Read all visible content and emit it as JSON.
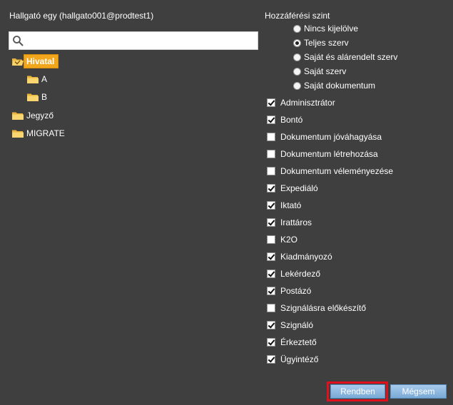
{
  "user": {
    "label": "Hallgató egy (hallgato001@prodtest1)"
  },
  "search": {
    "placeholder": "",
    "value": ""
  },
  "tree": {
    "nodes": [
      {
        "label": "Hivatal",
        "selected": true
      },
      {
        "label": "A"
      },
      {
        "label": "B"
      },
      {
        "label": "Jegyző"
      },
      {
        "label": "MIGRATE"
      }
    ]
  },
  "access": {
    "title": "Hozzáférési szint",
    "options": [
      {
        "label": "Nincs kijelölve",
        "checked": false
      },
      {
        "label": "Teljes szerv",
        "checked": true
      },
      {
        "label": "Saját és alárendelt szerv",
        "checked": false
      },
      {
        "label": "Saját szerv",
        "checked": false
      },
      {
        "label": "Saját dokumentum",
        "checked": false
      }
    ]
  },
  "roles": [
    {
      "label": "Adminisztrátor",
      "checked": true
    },
    {
      "label": "Bontó",
      "checked": true
    },
    {
      "label": "Dokumentum jóváhagyása",
      "checked": false
    },
    {
      "label": "Dokumentum létrehozása",
      "checked": false
    },
    {
      "label": "Dokumentum véleményezése",
      "checked": false
    },
    {
      "label": "Expediáló",
      "checked": true
    },
    {
      "label": "Iktató",
      "checked": true
    },
    {
      "label": "Irattáros",
      "checked": true
    },
    {
      "label": "K2O",
      "checked": false
    },
    {
      "label": "Kiadmányozó",
      "checked": true
    },
    {
      "label": "Lekérdező",
      "checked": true
    },
    {
      "label": "Postázó",
      "checked": true
    },
    {
      "label": "Szignálásra előkészítő",
      "checked": false
    },
    {
      "label": "Szignáló",
      "checked": true
    },
    {
      "label": "Érkeztető",
      "checked": true
    },
    {
      "label": "Ügyintéző",
      "checked": true
    }
  ],
  "buttons": {
    "ok": "Rendben",
    "cancel": "Mégsem"
  },
  "colors": {
    "background": "#3f3f3f",
    "selected": "#f1a61c",
    "highlight": "#e0101e",
    "button": "#8fbbe2"
  }
}
